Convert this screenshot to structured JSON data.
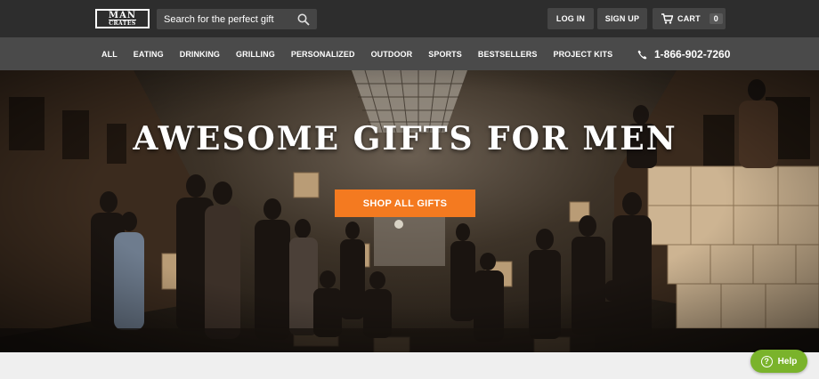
{
  "header": {
    "logo": {
      "line1": "MAN",
      "line2": "CRATES"
    },
    "search": {
      "placeholder": "Search for the perfect gift",
      "icon": "search-icon"
    },
    "login_label": "LOG IN",
    "signup_label": "SIGN UP",
    "cart": {
      "label": "CART",
      "count": "0",
      "icon": "cart-icon"
    }
  },
  "nav": {
    "items": [
      "ALL",
      "EATING",
      "DRINKING",
      "GRILLING",
      "PERSONALIZED",
      "OUTDOOR",
      "SPORTS",
      "BESTSELLERS",
      "PROJECT KITS"
    ],
    "phone": {
      "icon": "phone-icon",
      "number": "1-866-902-7260"
    }
  },
  "hero": {
    "title": "AWESOME GIFTS FOR MEN",
    "cta_label": "SHOP ALL GIFTS"
  },
  "help": {
    "label": "Help",
    "icon_glyph": "?"
  },
  "colors": {
    "topbar": "#2d2d2d",
    "nav": "#4a4a4a",
    "accent": "#f47a20",
    "help": "#7ab32b"
  }
}
